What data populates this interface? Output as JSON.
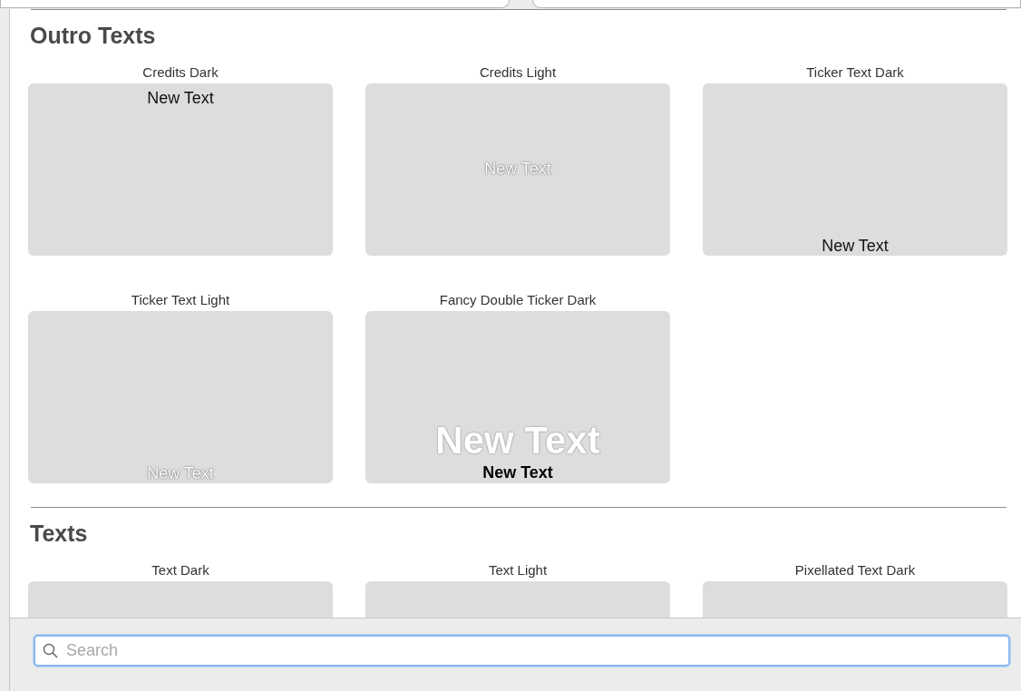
{
  "sections": [
    {
      "title": "Outro Texts",
      "items": [
        {
          "label": "Credits Dark",
          "texts": [
            {
              "text": "New Text",
              "kind": "dark-top"
            }
          ]
        },
        {
          "label": "Credits Light",
          "texts": [
            {
              "text": "New Text",
              "kind": "light-middle"
            }
          ]
        },
        {
          "label": "Ticker Text Dark",
          "texts": [
            {
              "text": "New Text",
              "kind": "dark-bottom"
            }
          ]
        },
        {
          "label": "Ticker Text Light",
          "texts": [
            {
              "text": "New Text",
              "kind": "light-bottom"
            }
          ]
        },
        {
          "label": "Fancy Double Ticker Dark",
          "texts": [
            {
              "text": "New Text",
              "kind": "faint-large"
            },
            {
              "text": "New Text",
              "kind": "bold-bottom"
            }
          ]
        }
      ]
    },
    {
      "title": "Texts",
      "items": [
        {
          "label": "Text Dark"
        },
        {
          "label": "Text Light"
        },
        {
          "label": "Pixellated Text Dark"
        }
      ]
    }
  ],
  "search": {
    "placeholder": "Search"
  }
}
